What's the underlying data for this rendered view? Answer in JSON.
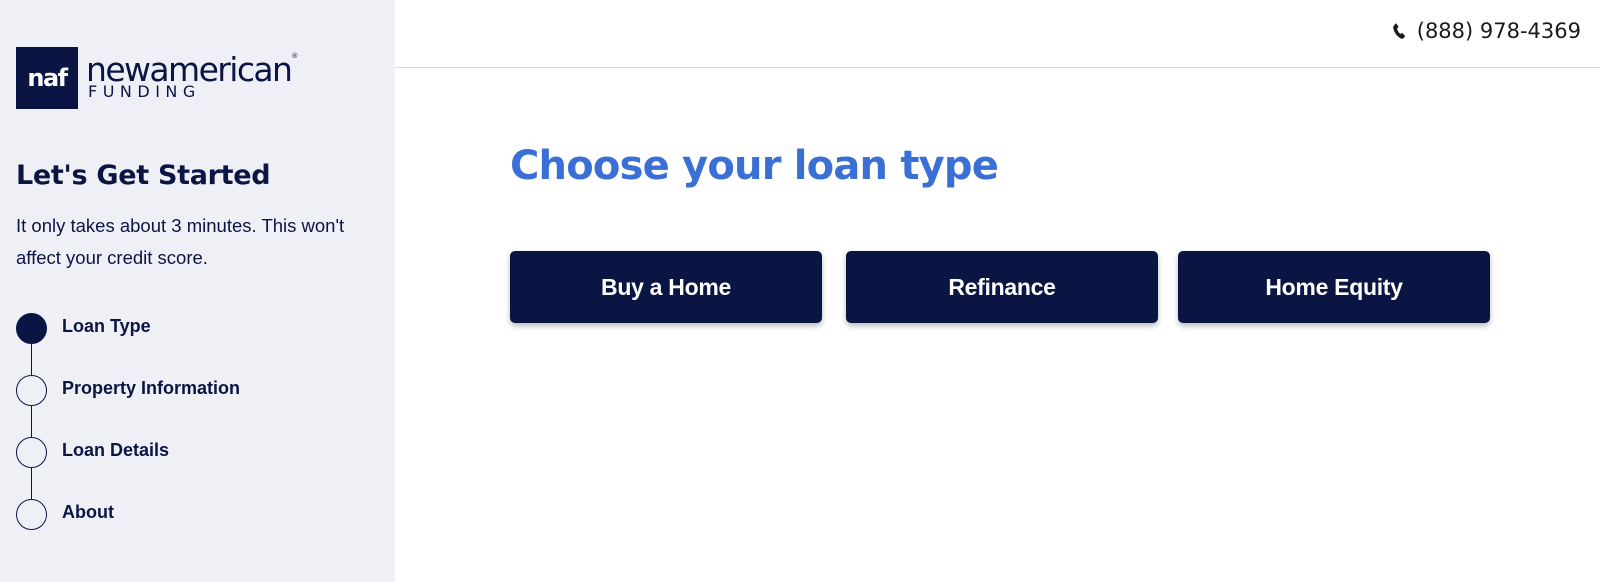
{
  "brand": {
    "logo_mark": "naf",
    "logo_word": "newamerican",
    "logo_registered": "®",
    "logo_sub": "FUNDING",
    "primary_color": "#0b1544",
    "accent_color": "#3a6fd6"
  },
  "header": {
    "phone_icon": "phone-icon",
    "phone_number": "(888) 978-4369"
  },
  "sidebar": {
    "title": "Let's Get Started",
    "description": "It only takes about 3 minutes. This won't affect your credit score.",
    "steps": [
      {
        "label": "Loan Type",
        "state": "active"
      },
      {
        "label": "Property Information",
        "state": "pending"
      },
      {
        "label": "Loan Details",
        "state": "pending"
      },
      {
        "label": "About",
        "state": "pending"
      }
    ]
  },
  "main": {
    "title": "Choose your loan type",
    "options": [
      {
        "label": "Buy a Home"
      },
      {
        "label": "Refinance"
      },
      {
        "label": "Home Equity"
      }
    ]
  }
}
